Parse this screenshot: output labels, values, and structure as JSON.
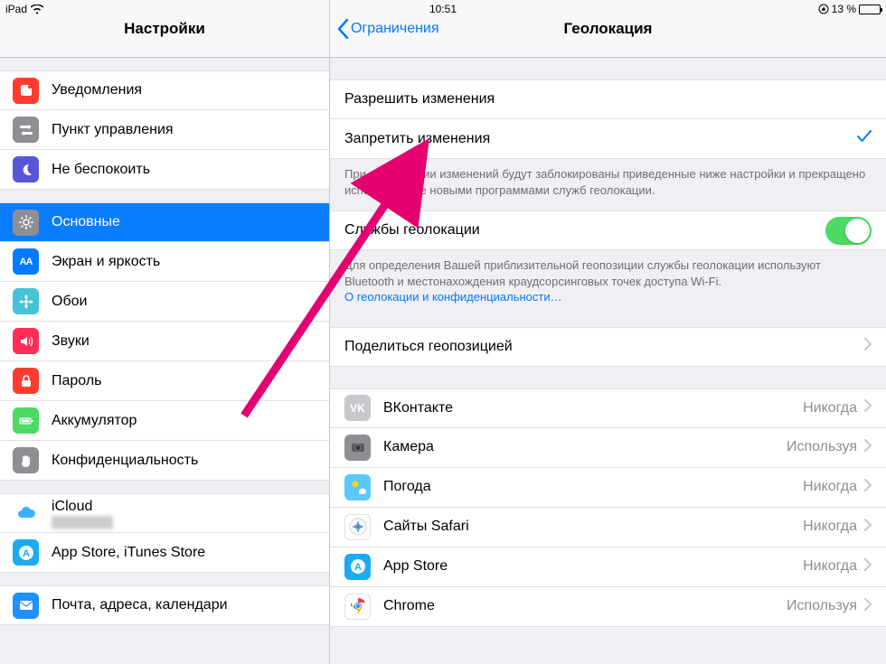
{
  "statusbar": {
    "device": "iPad",
    "time": "10:51",
    "battery_pct": "13 %"
  },
  "sidebar": {
    "title": "Настройки",
    "groups": [
      {
        "items": [
          {
            "key": "notifications",
            "label": "Уведомления",
            "icon_bg": "#ff3b30",
            "icon": "notif"
          },
          {
            "key": "control-center",
            "label": "Пункт управления",
            "icon_bg": "#8e8e93",
            "icon": "toggles"
          },
          {
            "key": "dnd",
            "label": "Не беспокоить",
            "icon_bg": "#5856d6",
            "icon": "moon"
          }
        ]
      },
      {
        "items": [
          {
            "key": "general",
            "label": "Основные",
            "icon_bg": "#8e8e93",
            "icon": "gear",
            "selected": true
          },
          {
            "key": "display",
            "label": "Экран и яркость",
            "icon_bg": "#007aff",
            "icon": "aa"
          },
          {
            "key": "wallpaper",
            "label": "Обои",
            "icon_bg": "#44c2d6",
            "icon": "flower"
          },
          {
            "key": "sounds",
            "label": "Звуки",
            "icon_bg": "#ff2d55",
            "icon": "speaker"
          },
          {
            "key": "passcode",
            "label": "Пароль",
            "icon_bg": "#ff3b30",
            "icon": "lock"
          },
          {
            "key": "battery",
            "label": "Аккумулятор",
            "icon_bg": "#4cd964",
            "icon": "battery"
          },
          {
            "key": "privacy",
            "label": "Конфиденциальность",
            "icon_bg": "#8e8e93",
            "icon": "hand"
          }
        ]
      },
      {
        "items": [
          {
            "key": "icloud",
            "label": "iCloud",
            "icon_bg": "#ffffff",
            "icon": "cloud",
            "sub": ""
          },
          {
            "key": "appstore",
            "label": "App Store, iTunes Store",
            "icon_bg": "#1eaaf1",
            "icon": "appstore"
          }
        ]
      },
      {
        "items": [
          {
            "key": "mail",
            "label": "Почта, адреса, календари",
            "icon_bg": "#1e90ff",
            "icon": "mail"
          }
        ]
      }
    ]
  },
  "detail": {
    "back_label": "Ограничения",
    "title": "Геолокация",
    "changes": {
      "allow": "Разрешить изменения",
      "deny": "Запретить изменения",
      "footer": "При запрещении изменений будут заблокированы приведенные ниже настройки и прекращено использование новыми программами служб геолокации."
    },
    "services": {
      "label": "Службы геолокации",
      "on": true,
      "footer1": "Для определения Вашей приблизительной геопозиции службы геолокации используют Bluetooth и местонахождения краудсорсинговых точек доступа Wi-Fi.",
      "link": "О геолокации и конфиденциальности…"
    },
    "share": {
      "label": "Поделиться геопозицией"
    },
    "apps": [
      {
        "key": "vk",
        "label": "ВКонтакте",
        "value": "Никогда",
        "bg": "#c7c7cc",
        "glyph": "VK"
      },
      {
        "key": "camera",
        "label": "Камера",
        "value": "Используя",
        "bg": "#8e8e93",
        "glyph": "cam"
      },
      {
        "key": "weather",
        "label": "Погода",
        "value": "Никогда",
        "bg": "#5ac8fa",
        "glyph": "sun"
      },
      {
        "key": "safari",
        "label": "Сайты Safari",
        "value": "Никогда",
        "bg": "#ffffff",
        "glyph": "compass"
      },
      {
        "key": "appstore",
        "label": "App Store",
        "value": "Никогда",
        "bg": "#1eaaf1",
        "glyph": "A"
      },
      {
        "key": "chrome",
        "label": "Chrome",
        "value": "Используя",
        "bg": "#ffffff",
        "glyph": "chrome"
      }
    ]
  }
}
